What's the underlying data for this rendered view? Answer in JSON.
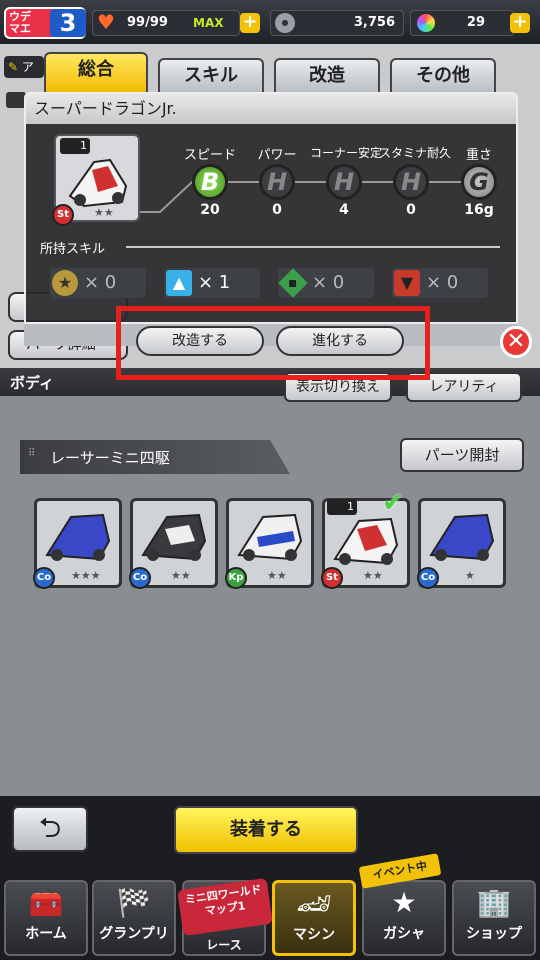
{
  "header": {
    "rank_label": "ウデマエ",
    "rank_value": "3",
    "stamina": "99/99",
    "stamina_max": "MAX",
    "coins": "3,756",
    "gems": "29"
  },
  "tabs": [
    "総合",
    "スキル",
    "改造",
    "その他"
  ],
  "popup": {
    "title": "スーパードラゴンJr.",
    "car_count": "1",
    "car_badge": "St",
    "car_stars": "★★",
    "stats": [
      {
        "label": "スピード",
        "grade": "B",
        "value": "20"
      },
      {
        "label": "パワー",
        "grade": "H",
        "value": "0"
      },
      {
        "label": "コーナー安定",
        "grade": "H",
        "value": "4"
      },
      {
        "label": "スタミナ耐久",
        "grade": "H",
        "value": "0"
      },
      {
        "label": "重さ",
        "grade": "G",
        "value": "16g"
      }
    ],
    "skills_label": "所持スキル",
    "skills": [
      {
        "icon": "star-icon",
        "count": "× 0",
        "color": "#b89a3a"
      },
      {
        "icon": "up-arrow-icon",
        "count": "× 1",
        "color": "#38b0e8"
      },
      {
        "icon": "diamond-icon",
        "count": "× 0",
        "color": "#3aa04a"
      },
      {
        "icon": "down-arrow-icon",
        "count": "× 0",
        "color": "#c83a2a"
      }
    ],
    "modify_button": "改造する",
    "evolve_button": "進化する"
  },
  "behind": {
    "parts_detail": "パーツ詳細",
    "display_toggle": "表示切り換え",
    "rarity": "レアリティ",
    "body_label": "ボディ",
    "partial_label": "ア"
  },
  "section": {
    "title": "レーサーミニ四駆",
    "open_button": "パーツ開封"
  },
  "parts": [
    {
      "badge": "Co",
      "stars": "★★★",
      "badge_color": "#2a6ad0"
    },
    {
      "badge": "Co",
      "stars": "★★",
      "badge_color": "#2a6ad0"
    },
    {
      "badge": "Kp",
      "stars": "★★",
      "badge_color": "#3aa040"
    },
    {
      "badge": "St",
      "stars": "★★",
      "badge_color": "#d03030",
      "count": "1",
      "equipped": true
    },
    {
      "badge": "Co",
      "stars": "★",
      "badge_color": "#2a6ad0"
    }
  ],
  "bottom": {
    "back": "⮌",
    "equip": "装着する",
    "event_badge": "イベント中"
  },
  "nav": [
    {
      "label": "ホーム",
      "icon": "toolbox-icon"
    },
    {
      "label": "グランプリ",
      "icon": "checkered-flag-icon"
    },
    {
      "label": "レース",
      "icon": "map-icon",
      "overlay": "ミニ四ワールドマップ1"
    },
    {
      "label": "マシン",
      "icon": "car-icon"
    },
    {
      "label": "ガシャ",
      "icon": "star-laurel-icon"
    },
    {
      "label": "ショップ",
      "icon": "building-icon"
    }
  ]
}
